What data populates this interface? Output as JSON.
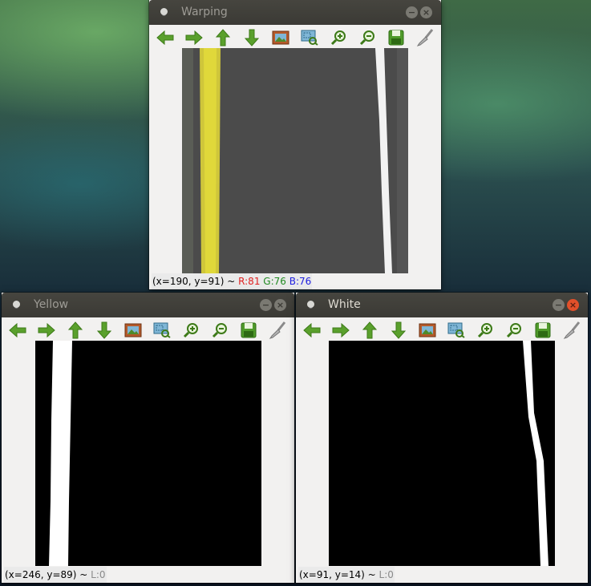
{
  "windows": {
    "warping": {
      "title": "Warping",
      "status": {
        "coords": "(x=190, y=91) ~ ",
        "r": "R:81",
        "g": " G:76",
        "b": " B:76"
      }
    },
    "yellow": {
      "title": "Yellow",
      "status": {
        "coords": "(x=246, y=89) ~ ",
        "l": "L:0"
      }
    },
    "white": {
      "title": "White",
      "status": {
        "coords": "(x=91, y=14) ~ ",
        "l": "L:0"
      }
    }
  },
  "window_buttons": {
    "minimize": "−",
    "close": "×"
  },
  "toolbar_icons": [
    "pan-left-icon",
    "pan-right-icon",
    "pan-up-icon",
    "pan-down-icon",
    "zoom-fit-icon",
    "zoom-region-icon",
    "zoom-in-icon",
    "zoom-out-icon",
    "save-icon",
    "properties-brush-icon"
  ],
  "colors": {
    "titlebar": "#3b3a35",
    "window_bg": "#f2f1f0",
    "close_active": "#e2502a",
    "road_asphalt": "#4b4b4b",
    "lane_yellow": "#d8cf2c",
    "lane_white": "#f4f4f4",
    "mask_black": "#000000",
    "mask_white": "#ffffff"
  }
}
